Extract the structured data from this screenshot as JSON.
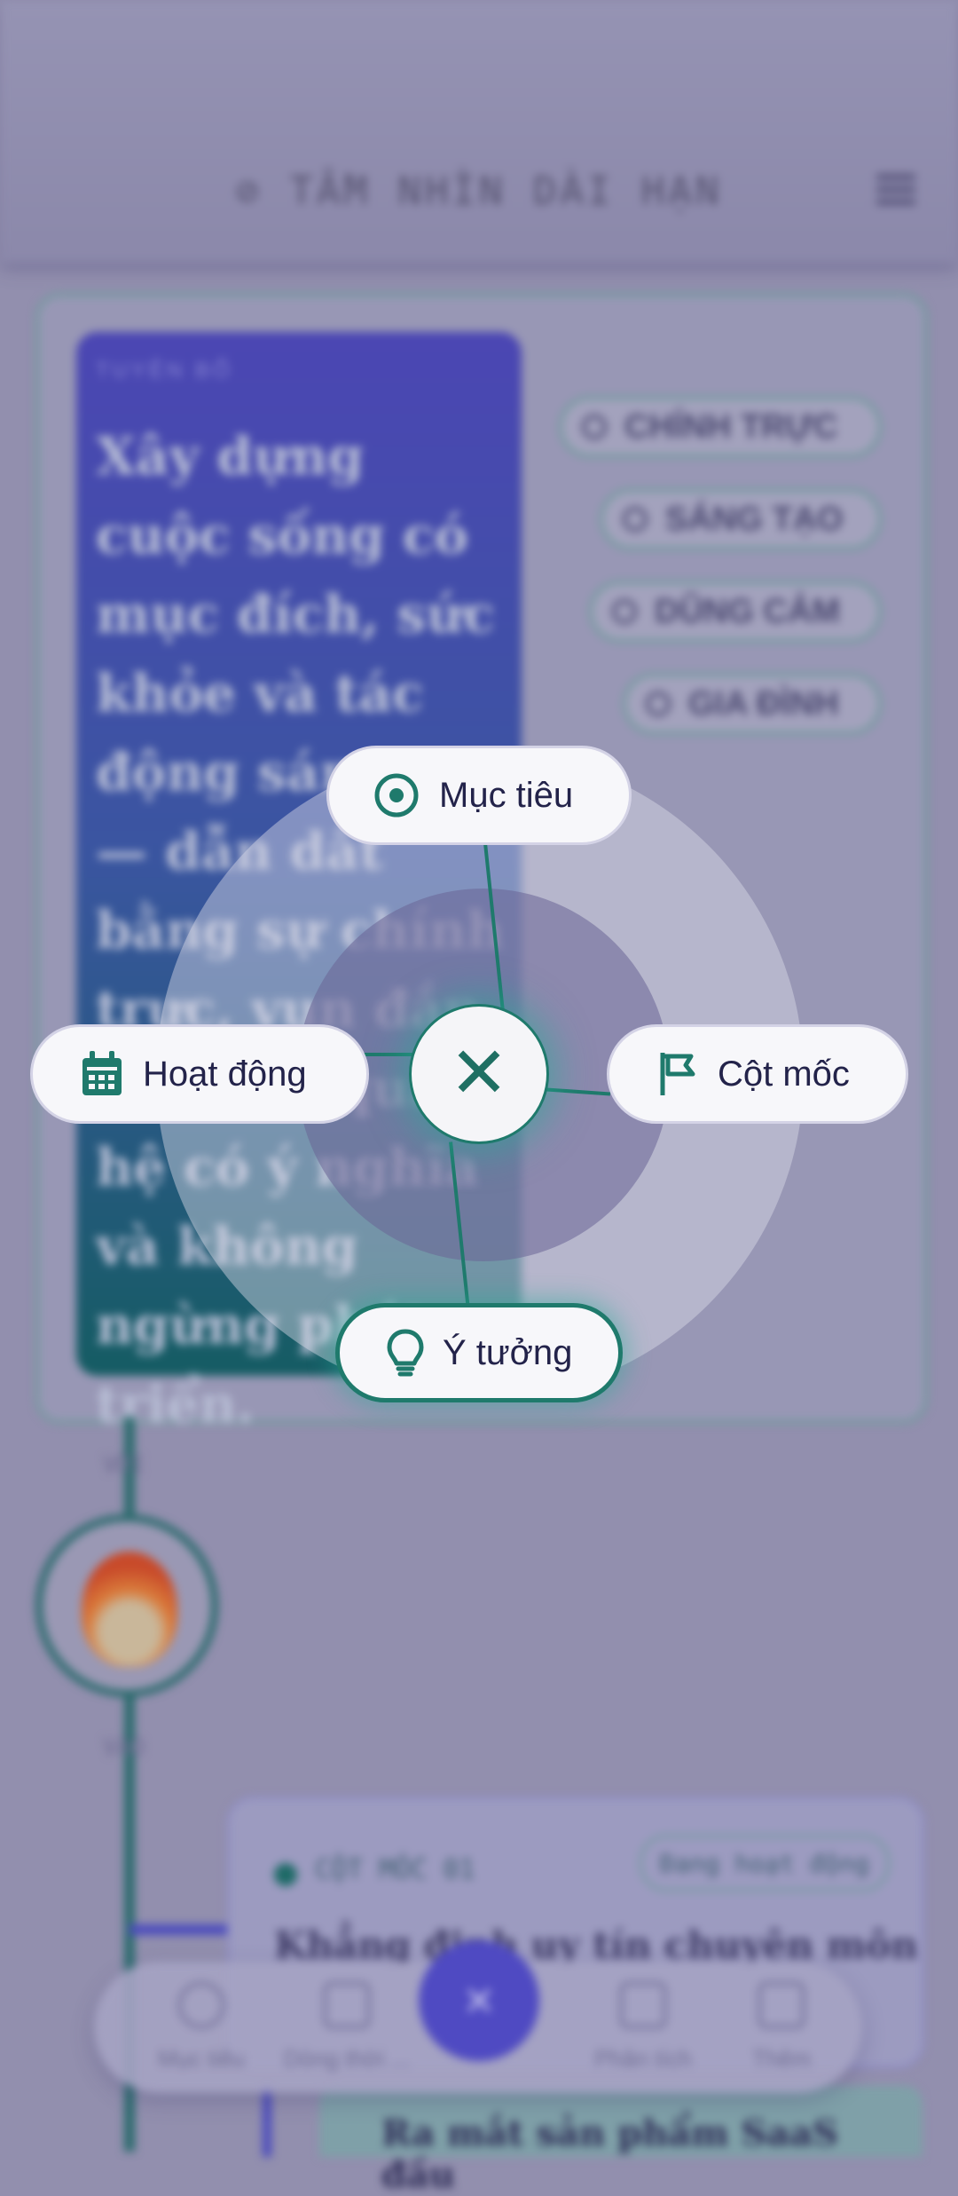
{
  "header": {
    "title": "⊘ TẦM NHÌN DÀI HẠN"
  },
  "vision": {
    "label": "TUYÊN BỐ",
    "statement": "Xây dựng cuộc sống có mục đích, sức khỏe và tác động sáng tạo — dẫn dắt bằng sự chính trực, vun đắp các mối quan hệ có ý nghĩa và không ngừng phát triển.",
    "values": [
      "CHÍNH TRỰC",
      "SÁNG TẠO",
      "DŨNG CẢM",
      "GIA ĐÌNH"
    ]
  },
  "timeline": {
    "top_label": "VỚI",
    "bottom_label": "VÀO"
  },
  "milestone": {
    "label": "CỘT MỐC 01",
    "status": "Đang hoạt động",
    "title": "Khẳng định uy tín chuyên môn",
    "next_card_title": "Ra mắt sản phẩm SaaS đầu"
  },
  "bottom_nav": {
    "items": [
      "Mục tiêu",
      "Dòng thời ...",
      "Phân tích",
      "Thêm"
    ],
    "fab_symbol": "×"
  },
  "radial_menu": {
    "close_symbol": "✕",
    "items": {
      "top": "Mục tiêu",
      "left": "Hoạt động",
      "right": "Cột mốc",
      "bottom": "Ý tưởng"
    }
  },
  "colors": {
    "accent": "#1f7a6c",
    "primary": "#4f4ac2",
    "scrim": "#928fae"
  }
}
